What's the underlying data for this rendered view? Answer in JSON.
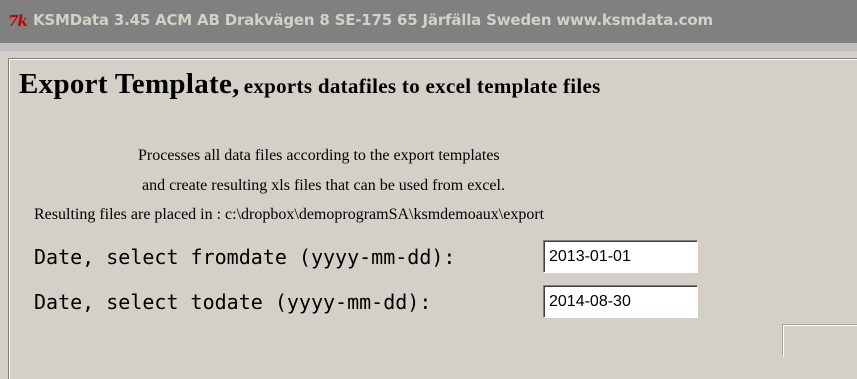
{
  "titlebar": {
    "logo_text": "7k",
    "title": "KSMData 3.45  ACM AB  Drakvägen 8  SE-175 65 Järfälla  Sweden  www.ksmdata.com"
  },
  "heading": {
    "main": "Export Template,",
    "sub": "exports datafiles to excel template files"
  },
  "description": {
    "line1": "Processes all data files according to the export templates",
    "line2": "and create resulting xls files that can be used from excel.",
    "line3": "Resulting files are placed in : c:\\dropbox\\demoprogramSA\\ksmdemoaux\\export"
  },
  "form": {
    "fromdate_label": "Date, select fromdate (yyyy-mm-dd):",
    "fromdate_value": "2013-01-01",
    "todate_label": "Date, select todate (yyyy-mm-dd):",
    "todate_value": "2014-08-30"
  },
  "colors": {
    "window_bg": "#d4d0c8",
    "titlebar_bg": "#808080",
    "titlebar_text": "#d4d0c8",
    "logo": "#c80000"
  }
}
